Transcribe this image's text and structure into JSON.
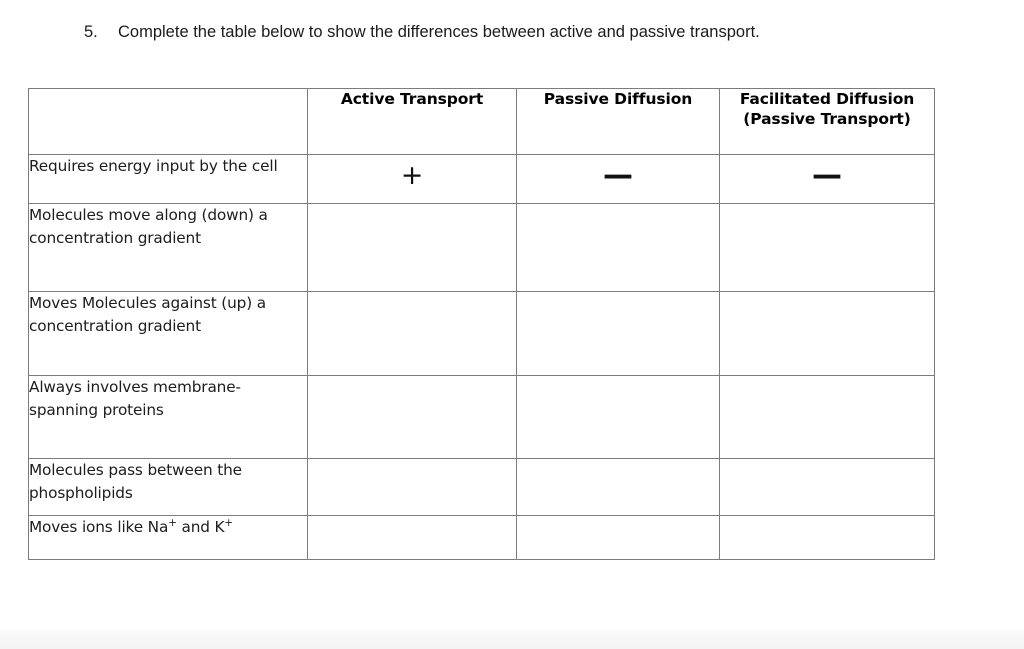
{
  "question": {
    "number": "5.",
    "text": "Complete the table below to show the differences between active and passive transport."
  },
  "table": {
    "corner_header": "",
    "column_headers": [
      "Active Transport",
      "Passive Diffusion",
      "Facilitated Diffusion (Passive Transport)"
    ],
    "column_headers_lines": {
      "col1_line1": "Active Transport",
      "col2_line1": "Passive Diffusion",
      "col3_line1": "Facilitated Diffusion",
      "col3_line2": "(Passive Transport)"
    },
    "rows": [
      {
        "label": "Requires energy input by the cell",
        "active_transport": "+",
        "passive_diffusion": "—",
        "facilitated_diffusion": "—"
      },
      {
        "label": "Molecules move along (down) a concentration gradient",
        "active_transport": "",
        "passive_diffusion": "",
        "facilitated_diffusion": ""
      },
      {
        "label": "Moves Molecules against (up) a concentration gradient",
        "active_transport": "",
        "passive_diffusion": "",
        "facilitated_diffusion": ""
      },
      {
        "label": "Always involves membrane-spanning proteins",
        "active_transport": "",
        "passive_diffusion": "",
        "facilitated_diffusion": ""
      },
      {
        "label": "Molecules pass between the phospholipids",
        "active_transport": "",
        "passive_diffusion": "",
        "facilitated_diffusion": ""
      },
      {
        "label": "Moves ions like Na+ and K+",
        "label_parts": {
          "prefix": "Moves ions like Na",
          "sup1": "+",
          "middle": " and K",
          "sup2": "+"
        },
        "active_transport": "",
        "passive_diffusion": "",
        "facilitated_diffusion": ""
      }
    ]
  },
  "colors": {
    "page_background": "#ffffff",
    "text": "#1a1a1a",
    "table_border": "#7c7c7c",
    "bottom_band": "#f4f4f4"
  }
}
